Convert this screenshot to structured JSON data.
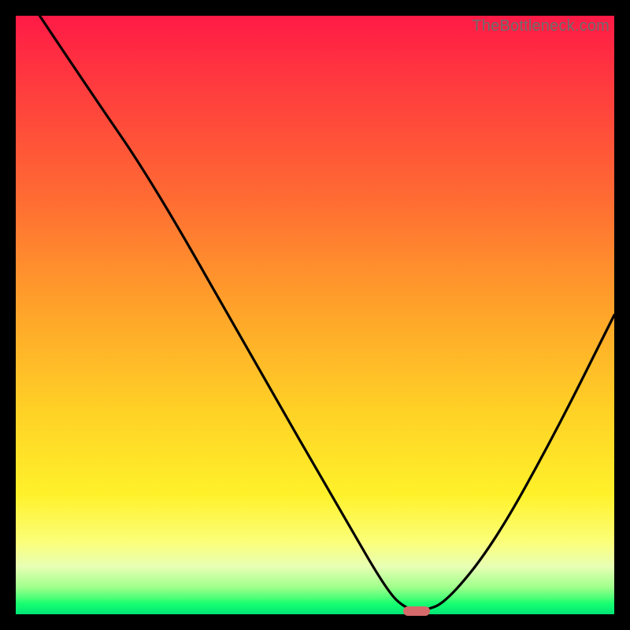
{
  "watermark": "TheBottleneck.com",
  "colors": {
    "frame": "#000000",
    "curve": "#000000",
    "marker": "#d66a6a",
    "gradient_stops": [
      "#ff1a46",
      "#ff3440",
      "#ff6a33",
      "#ffa02a",
      "#ffd126",
      "#fff12a",
      "#fbff7a",
      "#e8ffb4",
      "#9fff8c",
      "#4cff78",
      "#17ff70",
      "#00e676"
    ]
  },
  "chart_data": {
    "type": "line",
    "title": "",
    "xlabel": "",
    "ylabel": "",
    "xlim": [
      0,
      100
    ],
    "ylim": [
      0,
      100
    ],
    "grid": false,
    "legend": false,
    "x": [
      4,
      12,
      23,
      40,
      55,
      62,
      65,
      68,
      72,
      80,
      90,
      100
    ],
    "y": [
      100,
      88,
      72,
      42,
      16,
      4,
      1,
      0.5,
      2,
      12,
      30,
      50
    ],
    "note": "y is read as percent of plot height from bottom (0) to top (100); curve starts at top-left, descends to a minimum near x≈67, small flat segment ~x 65–68, then rises to ~50% at right edge.",
    "marker": {
      "x": 67,
      "y": 0.5,
      "shape": "pill"
    }
  }
}
